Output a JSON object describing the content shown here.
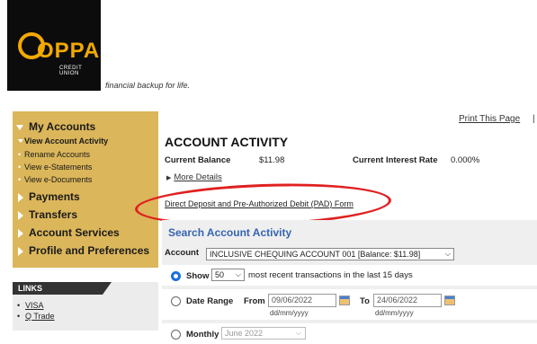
{
  "brand": {
    "logo_text": "OPPA",
    "logo_sub": "CREDIT UNION",
    "tagline": "financial backup for life."
  },
  "sidebar": {
    "items": [
      {
        "label": "My Accounts"
      },
      {
        "label": "View Account Activity"
      },
      {
        "label": "Rename Accounts"
      },
      {
        "label": "View e-Statements"
      },
      {
        "label": "View e-Documents"
      },
      {
        "label": "Payments"
      },
      {
        "label": "Transfers"
      },
      {
        "label": "Account Services"
      },
      {
        "label": "Profile and Preferences"
      }
    ]
  },
  "links": {
    "heading": "LINKS",
    "items": [
      "VISA",
      "Q Trade"
    ]
  },
  "print_label": "Print This Page",
  "print_sep": "|",
  "activity": {
    "title": "ACCOUNT ACTIVITY",
    "current_balance_label": "Current Balance",
    "current_balance_value": "$11.98",
    "interest_label": "Current Interest Rate",
    "interest_value": "0.000%",
    "more_details": "More Details",
    "pad_link": "Direct Deposit and Pre-Authorized Debit (PAD) Form"
  },
  "search": {
    "title": "Search Account Activity",
    "account_label": "Account",
    "account_value": "INCLUSIVE CHEQUING ACCOUNT 001 [Balance: $11.98]",
    "show_label": "Show",
    "show_value": "50",
    "show_suffix": "most recent transactions in the last 15 days",
    "date_range_label": "Date Range",
    "from_label": "From",
    "from_value": "09/06/2022",
    "to_label": "To",
    "to_value": "24/06/2022",
    "date_hint": "dd/mm/yyyy",
    "monthly_label": "Monthly",
    "monthly_value": "June 2022"
  },
  "colors": {
    "sidebar_bg": "#dbb65a",
    "logo_accent": "#f2a900",
    "search_title": "#3565b0",
    "highlight_oval": "#e02020"
  }
}
